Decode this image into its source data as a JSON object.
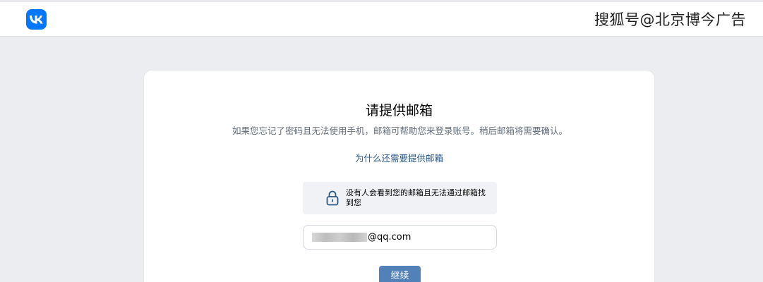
{
  "header": {
    "logo_icon": "vk-logo-icon",
    "brand_color": "#0077ff",
    "watermark": "搜狐号@北京博今广告"
  },
  "card": {
    "title": "请提供邮箱",
    "description": "如果您忘记了密码且无法使用手机，邮箱可帮助您来登录账号。稍后邮箱将需要确认。",
    "why_link": "为什么还需要提供邮箱",
    "notice": {
      "icon": "lock-icon",
      "text": "没有人会看到您的邮箱且无法通过邮箱找到您"
    },
    "email_field": {
      "value": "@qq.com"
    },
    "continue_button": "继续",
    "accent_color": "#5181b8"
  }
}
